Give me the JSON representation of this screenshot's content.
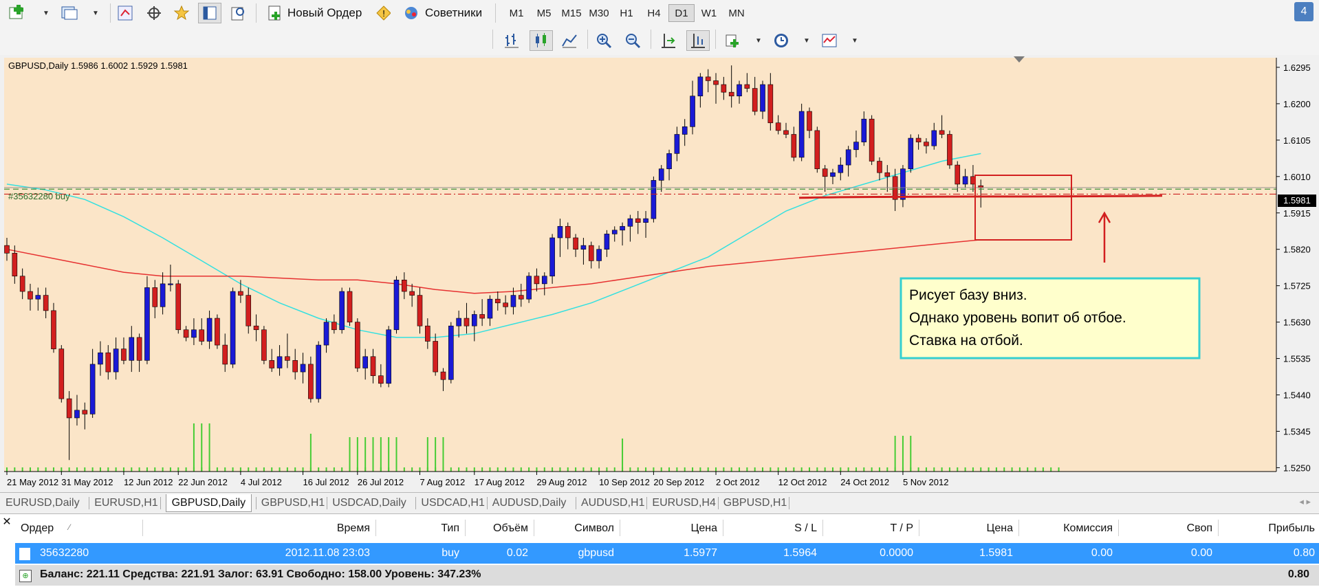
{
  "toolbar": {
    "new_order": "Новый Ордер",
    "advisors": "Советники",
    "timeframes": [
      "M1",
      "M5",
      "M15",
      "M30",
      "H1",
      "H4",
      "D1",
      "W1",
      "MN"
    ],
    "active_timeframe": "D1",
    "corner_badge": "4"
  },
  "chart": {
    "header": "GBPUSD,Daily  1.5986 1.6002 1.5929 1.5981",
    "order_label": "#35632280 buy",
    "current_price": "1.5981",
    "annotation": [
      "Рисует базу вниз.",
      "Однако уровень вопит об отбое.",
      "Ставка на отбой."
    ],
    "colors": {
      "bg": "#fbe5c8",
      "bull": "#1a1ad6",
      "bear": "#d21f1f",
      "volume": "#44cc33",
      "ma_fast": "#33e0e0",
      "ma_slow": "#e63030",
      "order": "#2e8b2e",
      "stop": "#cc2020"
    }
  },
  "chart_data": {
    "type": "candlestick",
    "symbol": "GBPUSD",
    "timeframe": "Daily",
    "y_ticks": [
      "1.6295",
      "1.6200",
      "1.6105",
      "1.6010",
      "1.5915",
      "1.5820",
      "1.5725",
      "1.5630",
      "1.5535",
      "1.5440",
      "1.5345",
      "1.5250"
    ],
    "x_ticks": [
      "21 May 2012",
      "31 May 2012",
      "12 Jun 2012",
      "22 Jun 2012",
      "4 Jul 2012",
      "16 Jul 2012",
      "26 Jul 2012",
      "7 Aug 2012",
      "17 Aug 2012",
      "29 Aug 2012",
      "10 Sep 2012",
      "20 Sep 2012",
      "2 Oct 2012",
      "12 Oct 2012",
      "24 Oct 2012",
      "5 Nov 2012"
    ],
    "ylim": [
      1.524,
      1.632
    ],
    "ohlc": [
      [
        1.583,
        1.585,
        1.579,
        1.581
      ],
      [
        1.581,
        1.583,
        1.573,
        1.575
      ],
      [
        1.575,
        1.577,
        1.569,
        1.571
      ],
      [
        1.571,
        1.573,
        1.566,
        1.569
      ],
      [
        1.569,
        1.572,
        1.566,
        1.57
      ],
      [
        1.57,
        1.572,
        1.564,
        1.566
      ],
      [
        1.566,
        1.568,
        1.555,
        1.556
      ],
      [
        1.556,
        1.557,
        1.542,
        1.543
      ],
      [
        1.543,
        1.545,
        1.527,
        1.538
      ],
      [
        1.538,
        1.544,
        1.536,
        1.54
      ],
      [
        1.54,
        1.542,
        1.535,
        1.539
      ],
      [
        1.539,
        1.556,
        1.538,
        1.552
      ],
      [
        1.552,
        1.558,
        1.549,
        1.555
      ],
      [
        1.555,
        1.557,
        1.548,
        1.55
      ],
      [
        1.55,
        1.559,
        1.548,
        1.556
      ],
      [
        1.556,
        1.559,
        1.552,
        1.553
      ],
      [
        1.553,
        1.562,
        1.55,
        1.559
      ],
      [
        1.559,
        1.56,
        1.55,
        1.553
      ],
      [
        1.553,
        1.575,
        1.552,
        1.572
      ],
      [
        1.572,
        1.574,
        1.564,
        1.567
      ],
      [
        1.567,
        1.576,
        1.565,
        1.573
      ],
      [
        1.573,
        1.578,
        1.571,
        1.573
      ],
      [
        1.573,
        1.574,
        1.56,
        1.561
      ],
      [
        1.561,
        1.562,
        1.558,
        1.559
      ],
      [
        1.559,
        1.564,
        1.557,
        1.561
      ],
      [
        1.561,
        1.564,
        1.557,
        1.558
      ],
      [
        1.558,
        1.566,
        1.556,
        1.564
      ],
      [
        1.564,
        1.565,
        1.556,
        1.557
      ],
      [
        1.557,
        1.56,
        1.55,
        1.552
      ],
      [
        1.552,
        1.572,
        1.551,
        1.571
      ],
      [
        1.571,
        1.574,
        1.568,
        1.57
      ],
      [
        1.57,
        1.572,
        1.56,
        1.562
      ],
      [
        1.562,
        1.565,
        1.558,
        1.561
      ],
      [
        1.561,
        1.562,
        1.552,
        1.553
      ],
      [
        1.553,
        1.556,
        1.55,
        1.551
      ],
      [
        1.551,
        1.557,
        1.549,
        1.554
      ],
      [
        1.554,
        1.56,
        1.551,
        1.553
      ],
      [
        1.553,
        1.556,
        1.548,
        1.55
      ],
      [
        1.55,
        1.555,
        1.547,
        1.552
      ],
      [
        1.552,
        1.554,
        1.542,
        1.543
      ],
      [
        1.543,
        1.558,
        1.542,
        1.557
      ],
      [
        1.557,
        1.564,
        1.555,
        1.563
      ],
      [
        1.563,
        1.565,
        1.56,
        1.561
      ],
      [
        1.561,
        1.572,
        1.56,
        1.571
      ],
      [
        1.571,
        1.572,
        1.562,
        1.563
      ],
      [
        1.563,
        1.564,
        1.55,
        1.551
      ],
      [
        1.551,
        1.556,
        1.548,
        1.554
      ],
      [
        1.554,
        1.556,
        1.547,
        1.549
      ],
      [
        1.549,
        1.552,
        1.546,
        1.547
      ],
      [
        1.547,
        1.562,
        1.546,
        1.561
      ],
      [
        1.561,
        1.575,
        1.56,
        1.574
      ],
      [
        1.574,
        1.576,
        1.569,
        1.571
      ],
      [
        1.571,
        1.573,
        1.567,
        1.57
      ],
      [
        1.57,
        1.572,
        1.56,
        1.562
      ],
      [
        1.562,
        1.564,
        1.556,
        1.558
      ],
      [
        1.558,
        1.56,
        1.549,
        1.55
      ],
      [
        1.55,
        1.551,
        1.545,
        1.548
      ],
      [
        1.548,
        1.563,
        1.547,
        1.562
      ],
      [
        1.562,
        1.566,
        1.559,
        1.564
      ],
      [
        1.564,
        1.568,
        1.56,
        1.562
      ],
      [
        1.562,
        1.566,
        1.558,
        1.565
      ],
      [
        1.565,
        1.569,
        1.562,
        1.564
      ],
      [
        1.564,
        1.57,
        1.562,
        1.569
      ],
      [
        1.569,
        1.571,
        1.566,
        1.568
      ],
      [
        1.568,
        1.57,
        1.565,
        1.567
      ],
      [
        1.567,
        1.572,
        1.565,
        1.57
      ],
      [
        1.57,
        1.573,
        1.567,
        1.569
      ],
      [
        1.569,
        1.576,
        1.568,
        1.575
      ],
      [
        1.575,
        1.577,
        1.571,
        1.573
      ],
      [
        1.573,
        1.576,
        1.57,
        1.575
      ],
      [
        1.575,
        1.586,
        1.573,
        1.585
      ],
      [
        1.585,
        1.59,
        1.58,
        1.588
      ],
      [
        1.588,
        1.589,
        1.582,
        1.585
      ],
      [
        1.585,
        1.586,
        1.58,
        1.582
      ],
      [
        1.582,
        1.585,
        1.578,
        1.583
      ],
      [
        1.583,
        1.584,
        1.577,
        1.579
      ],
      [
        1.579,
        1.583,
        1.577,
        1.582
      ],
      [
        1.582,
        1.587,
        1.58,
        1.586
      ],
      [
        1.586,
        1.588,
        1.584,
        1.587
      ],
      [
        1.587,
        1.589,
        1.583,
        1.588
      ],
      [
        1.588,
        1.591,
        1.584,
        1.59
      ],
      [
        1.59,
        1.592,
        1.586,
        1.589
      ],
      [
        1.589,
        1.592,
        1.585,
        1.59
      ],
      [
        1.59,
        1.601,
        1.589,
        1.6
      ],
      [
        1.6,
        1.604,
        1.597,
        1.603
      ],
      [
        1.603,
        1.608,
        1.6,
        1.607
      ],
      [
        1.607,
        1.614,
        1.605,
        1.612
      ],
      [
        1.612,
        1.616,
        1.609,
        1.614
      ],
      [
        1.614,
        1.626,
        1.612,
        1.622
      ],
      [
        1.622,
        1.628,
        1.619,
        1.627
      ],
      [
        1.627,
        1.629,
        1.623,
        1.626
      ],
      [
        1.626,
        1.628,
        1.62,
        1.625
      ],
      [
        1.625,
        1.627,
        1.621,
        1.623
      ],
      [
        1.623,
        1.63,
        1.619,
        1.622
      ],
      [
        1.622,
        1.626,
        1.62,
        1.625
      ],
      [
        1.625,
        1.628,
        1.623,
        1.624
      ],
      [
        1.624,
        1.627,
        1.617,
        1.618
      ],
      [
        1.618,
        1.626,
        1.616,
        1.625
      ],
      [
        1.625,
        1.628,
        1.613,
        1.615
      ],
      [
        1.615,
        1.617,
        1.612,
        1.613
      ],
      [
        1.613,
        1.615,
        1.611,
        1.612
      ],
      [
        1.612,
        1.614,
        1.605,
        1.606
      ],
      [
        1.606,
        1.62,
        1.605,
        1.618
      ],
      [
        1.618,
        1.619,
        1.611,
        1.613
      ],
      [
        1.613,
        1.614,
        1.602,
        1.603
      ],
      [
        1.603,
        1.604,
        1.597,
        1.601
      ],
      [
        1.601,
        1.603,
        1.599,
        1.602
      ],
      [
        1.602,
        1.606,
        1.6,
        1.604
      ],
      [
        1.604,
        1.609,
        1.601,
        1.608
      ],
      [
        1.608,
        1.613,
        1.606,
        1.61
      ],
      [
        1.61,
        1.618,
        1.609,
        1.616
      ],
      [
        1.616,
        1.617,
        1.604,
        1.605
      ],
      [
        1.605,
        1.606,
        1.6,
        1.602
      ],
      [
        1.602,
        1.604,
        1.597,
        1.601
      ],
      [
        1.601,
        1.603,
        1.592,
        1.595
      ],
      [
        1.595,
        1.604,
        1.593,
        1.603
      ],
      [
        1.603,
        1.612,
        1.602,
        1.611
      ],
      [
        1.611,
        1.612,
        1.608,
        1.61
      ],
      [
        1.61,
        1.611,
        1.607,
        1.609
      ],
      [
        1.609,
        1.615,
        1.608,
        1.613
      ],
      [
        1.613,
        1.617,
        1.611,
        1.612
      ],
      [
        1.612,
        1.613,
        1.603,
        1.604
      ],
      [
        1.604,
        1.605,
        1.597,
        1.599
      ],
      [
        1.599,
        1.603,
        1.598,
        1.601
      ],
      [
        1.601,
        1.604,
        1.597,
        1.599
      ],
      [
        1.5986,
        1.6002,
        1.5929,
        1.5981
      ]
    ],
    "volume": [
      0.05,
      0.05,
      0.05,
      0.05,
      0.05,
      0.05,
      0.05,
      0.05,
      0.05,
      0.05,
      0.05,
      0.05,
      0.05,
      0.05,
      0.05,
      0.05,
      0.05,
      0.05,
      0.05,
      0.05,
      0.05,
      0.05,
      0.05,
      0.05,
      0.05,
      0.05,
      0.05,
      0.05,
      0.05,
      0.05,
      0.05,
      0.05,
      0.05,
      0.05,
      0.05,
      0.05,
      0.05,
      0.05,
      0.05,
      0.05,
      0.05,
      0.05,
      0.05,
      0.05,
      0.05,
      0.05,
      0.05,
      0.05,
      0.05,
      0.05,
      0.05,
      0.05,
      0.05,
      0.05,
      0.05,
      0.05,
      0.05,
      0.05,
      0.05,
      0.05,
      0.05,
      0.05,
      0.05,
      0.05,
      0.05,
      0.05,
      0.05,
      0.05,
      0.05,
      0.05,
      0.05,
      0.05,
      0.05,
      0.05,
      0.05,
      0.05,
      0.05,
      0.05,
      0.05,
      0.05,
      0.05,
      0.05,
      0.05,
      0.05,
      0.05,
      0.05,
      0.05,
      0.05,
      0.05,
      0.05,
      0.05,
      0.05,
      0.05,
      0.05,
      0.05,
      0.05,
      0.05,
      0.05,
      0.05,
      0.05,
      0.05,
      0.05,
      0.05,
      0.05,
      0.05,
      0.05,
      0.05,
      0.05,
      0.05,
      0.05,
      0.05,
      0.05,
      0.05,
      0.05,
      0.05,
      0.05,
      0.05,
      0.05,
      0.05,
      0.05,
      0.05,
      0.05,
      0.05,
      0.05,
      0.05,
      0.05,
      0.05,
      0.05,
      0.05,
      0.05,
      0.05,
      0.05,
      0.05,
      0.05,
      0.05,
      0.05
    ],
    "order_price": 1.5977,
    "sl_price": 1.5964,
    "support_level": 1.5958,
    "ma_fast": {
      "start": 1.599,
      "path": [
        1.599,
        1.5975,
        1.595,
        1.5905,
        1.585,
        1.579,
        1.573,
        1.568,
        1.564,
        1.561,
        1.559,
        1.559,
        1.56,
        1.5625,
        1.565,
        1.568,
        1.572,
        1.576,
        1.58,
        1.586,
        1.592,
        1.596,
        1.599,
        1.602,
        1.605,
        1.607
      ]
    },
    "ma_slow": {
      "path": [
        1.582,
        1.58,
        1.578,
        1.576,
        1.575,
        1.575,
        1.575,
        1.5745,
        1.574,
        1.574,
        1.573,
        1.5715,
        1.5705,
        1.571,
        1.572,
        1.573,
        1.5745,
        1.576,
        1.5775,
        1.5785,
        1.5795,
        1.5805,
        1.5815,
        1.5825,
        1.5835,
        1.5845
      ]
    }
  },
  "chart_tabs": [
    "EURUSD,Daily",
    "EURUSD,H1",
    "GBPUSD,Daily",
    "GBPUSD,H1",
    "USDCAD,Daily",
    "USDCAD,H1",
    "AUDUSD,Daily",
    "AUDUSD,H1",
    "EURUSD,H4",
    "GBPUSD,H1"
  ],
  "active_chart_tab": "GBPUSD,Daily",
  "terminal": {
    "columns": [
      "Ордер",
      "Время",
      "Тип",
      "Объём",
      "Символ",
      "Цена",
      "S / L",
      "T / P",
      "Цена",
      "Комиссия",
      "Своп",
      "Прибыль"
    ],
    "order_row": [
      "35632280",
      "2012.11.08 23:03",
      "buy",
      "0.02",
      "gbpusd",
      "1.5977",
      "1.5964",
      "0.0000",
      "1.5981",
      "0.00",
      "0.00",
      "0.80"
    ],
    "balance_text": "Баланс: 221.11  Средства: 221.91  Залог: 63.91  Свободно: 158.00  Уровень: 347.23%",
    "balance_profit": "0.80"
  }
}
